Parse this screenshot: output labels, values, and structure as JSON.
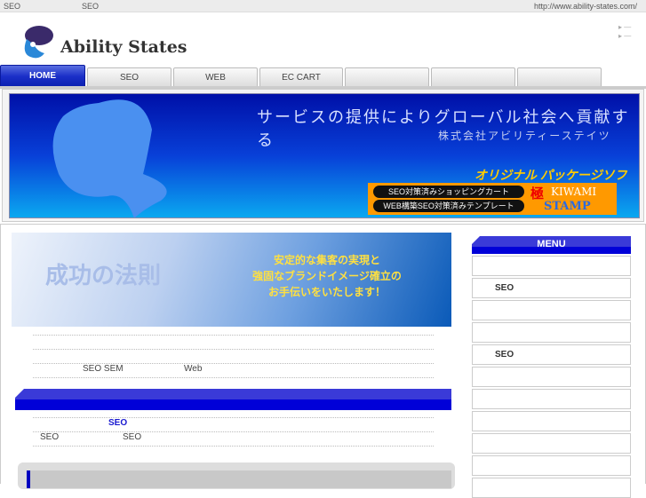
{
  "topbar": {
    "left1": "SEO",
    "left2": "SEO",
    "url": "http://www.ability-states.com/"
  },
  "header": {
    "logo_text": "Ability States"
  },
  "nav": {
    "tabs": [
      "HOME",
      "SEO",
      "WEB",
      "EC CART",
      "",
      "",
      ""
    ]
  },
  "banner": {
    "slogan": "サービスの提供によりグローバル社会へ貢献する",
    "company": "株式会社アビリティーステイツ",
    "original": "オリジナル パッケージソフト",
    "pill1": "SEO対策済みショッピングカート",
    "pill2": "WEB構築SEO対策済みテンプレート",
    "kiwami_kanji": "極",
    "kiwami": "KIWAMI",
    "stamp": "STAMP"
  },
  "success": {
    "title": "成功の法則",
    "copy": [
      "安定的な集客の実現と",
      "強固なブランドイメージ確立の",
      "お手伝いをいたします！"
    ]
  },
  "main": {
    "line1": "SEO  SEM",
    "line1b": "Web",
    "link": "SEO",
    "line2a": "SEO",
    "line2b": "SEO"
  },
  "menu": {
    "title": "MENU",
    "items": [
      "",
      "SEO",
      "",
      "",
      "SEO",
      "",
      "",
      "",
      "",
      "",
      ""
    ]
  },
  "colors": {
    "nav_active": "#1b2fc8",
    "bar": "#0000d8",
    "banner": "#0840d8"
  }
}
